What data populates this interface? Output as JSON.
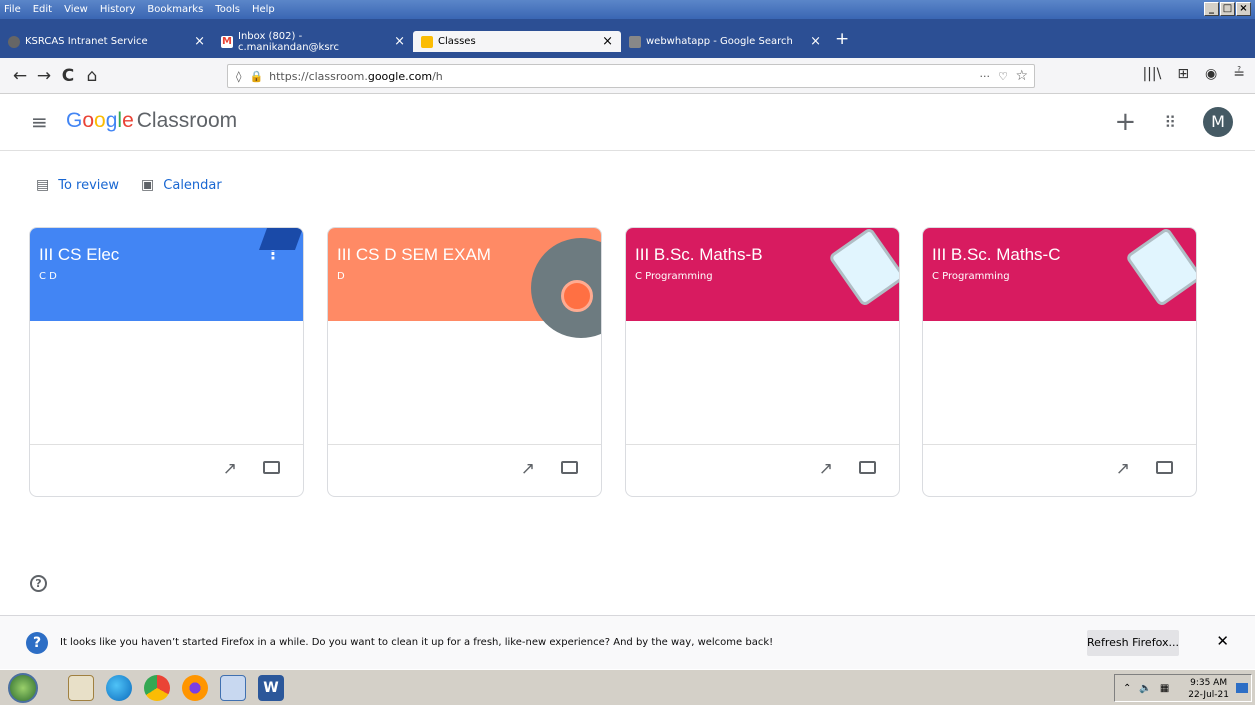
{
  "menubar": {
    "items": [
      "File",
      "Edit",
      "View",
      "History",
      "Bookmarks",
      "Tools",
      "Help"
    ]
  },
  "tabs": [
    {
      "label": "KSRCAS Intranet Service",
      "favicon_color": "#666666",
      "close": "×"
    },
    {
      "label": "Inbox (802) - c.manikandan@ksrc",
      "favicon_color": "#ea4335",
      "close": "×"
    },
    {
      "label": "Classes",
      "favicon_color": "#fbbc04",
      "close": "×",
      "active": true
    },
    {
      "label": "webwhatapp - Google Search",
      "favicon_color": "#888888",
      "close": "×"
    }
  ],
  "newtab": "+",
  "nav": {
    "back": "←",
    "forward": "→",
    "reload": "C",
    "home": "⌂",
    "url_prefix": "https://classroom.",
    "url_domain": "google.com",
    "url_suffix": "/h",
    "more": "···",
    "pocket": "♡",
    "star": "☆"
  },
  "toolbar_icons": [
    "|||\\",
    "⊞",
    "◉",
    "≟"
  ],
  "app": {
    "menu_icon": "≡",
    "logo_G": "G",
    "logo_o1": "o",
    "logo_o2": "o",
    "logo_g": "g",
    "logo_l": "l",
    "logo_e": "e",
    "logo_product": "Classroom",
    "add_icon": "+",
    "apps_icon": "⋮⋮⋮",
    "avatar_letter": "M"
  },
  "subnav": {
    "to_review": "To review",
    "calendar": "Calendar"
  },
  "cards": [
    {
      "title": "III CS Elec",
      "section": "C D",
      "color": "#4285f4"
    },
    {
      "title": "III CS D SEM EXAM",
      "section": "D",
      "color": "#ff8a65"
    },
    {
      "title": "III B.Sc. Maths-B",
      "section": "C Programming",
      "color": "#d81b60"
    },
    {
      "title": "III B.Sc. Maths-C",
      "section": "C Programming",
      "color": "#d81b60"
    }
  ],
  "card_more": "⋮",
  "card_trend": "↗",
  "help_icon": "?",
  "notification": {
    "icon": "?",
    "message": "It looks like you haven’t started Firefox in a while. Do you want to clean it up for a fresh, like-new experience? And by the way, welcome back!",
    "button": "Refresh Firefox...",
    "close": "✕"
  },
  "taskbar": {
    "time": "9:35 AM",
    "date": "22-Jul-21"
  }
}
